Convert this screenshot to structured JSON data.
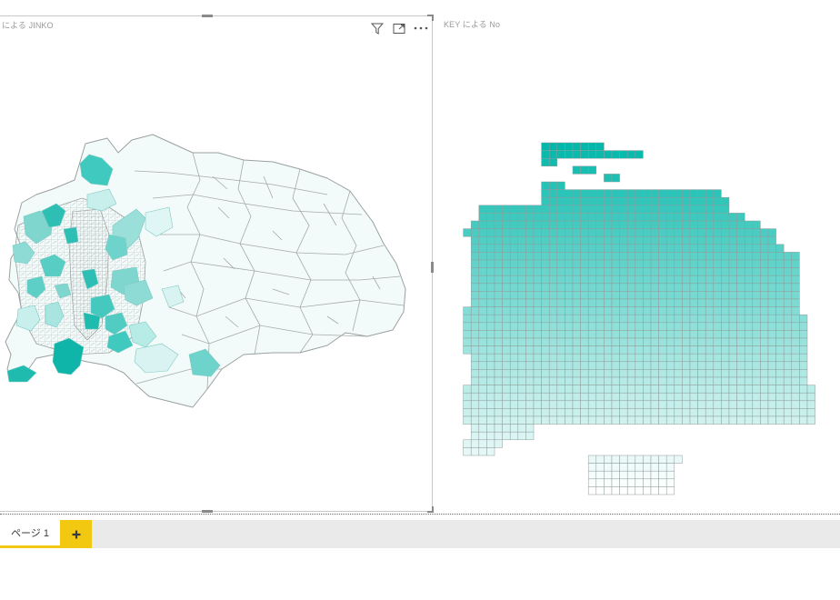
{
  "report": {
    "visuals": [
      {
        "id": "left",
        "title": "による JINKO",
        "type": "filled-map"
      },
      {
        "id": "right",
        "title": "KEY による No",
        "type": "grid-map"
      }
    ],
    "header_icons": [
      "filter-icon",
      "focus-mode-icon",
      "more-options-icon"
    ]
  },
  "pages": {
    "tabs": [
      {
        "label": "ページ 1",
        "active": true
      }
    ],
    "add_label": "+"
  },
  "colors": {
    "accent": "#01b8aa",
    "low": "#f4fcfb",
    "border": "#9aa0a0",
    "page_accent": "#f2c811",
    "pagebar_bg": "#eaeaea"
  },
  "grid_map": {
    "rows": [
      {
        "c0": 9,
        "n": 8
      },
      {
        "c0": 9,
        "n": 13
      },
      {
        "c0": 9,
        "n": 2
      },
      {
        "c0": 13,
        "n": 3
      },
      {
        "c0": 17,
        "n": 2
      },
      {
        "c0": 9,
        "n": 3
      },
      {
        "c0": 9,
        "n": 23
      },
      {
        "c0": 9,
        "n": 24
      },
      {
        "c0": 1,
        "n": 32
      },
      {
        "c0": 1,
        "n": 34
      },
      {
        "c0": 0,
        "n": 37
      },
      {
        "c0": -1,
        "n": 40
      },
      {
        "c0": 0,
        "n": 39
      },
      {
        "c0": 0,
        "n": 40
      },
      {
        "c0": 0,
        "n": 42
      },
      {
        "c0": 0,
        "n": 42
      },
      {
        "c0": 0,
        "n": 42
      },
      {
        "c0": 0,
        "n": 42
      },
      {
        "c0": 0,
        "n": 42
      },
      {
        "c0": 0,
        "n": 42
      },
      {
        "c0": 0,
        "n": 42
      },
      {
        "c0": -1,
        "n": 43
      },
      {
        "c0": -1,
        "n": 44
      },
      {
        "c0": -1,
        "n": 44
      },
      {
        "c0": -1,
        "n": 44
      },
      {
        "c0": -1,
        "n": 44
      },
      {
        "c0": -1,
        "n": 44
      },
      {
        "c0": 0,
        "n": 43
      },
      {
        "c0": 0,
        "n": 43
      },
      {
        "c0": 0,
        "n": 43
      },
      {
        "c0": 0,
        "n": 43
      },
      {
        "c0": -1,
        "n": 45
      },
      {
        "c0": -1,
        "n": 45
      },
      {
        "c0": -1,
        "n": 45
      },
      {
        "c0": -1,
        "n": 45
      },
      {
        "c0": -1,
        "n": 45
      },
      {
        "c0": 0,
        "n": 8
      },
      {
        "c0": 0,
        "n": 8
      },
      {
        "c0": -1,
        "n": 5
      },
      {
        "c0": -1,
        "n": 4
      },
      {
        "c0": 15,
        "n": 12
      },
      {
        "c0": 15,
        "n": 11
      },
      {
        "c0": 15,
        "n": 11
      },
      {
        "c0": 15,
        "n": 11
      },
      {
        "c0": 15,
        "n": 11
      }
    ]
  }
}
